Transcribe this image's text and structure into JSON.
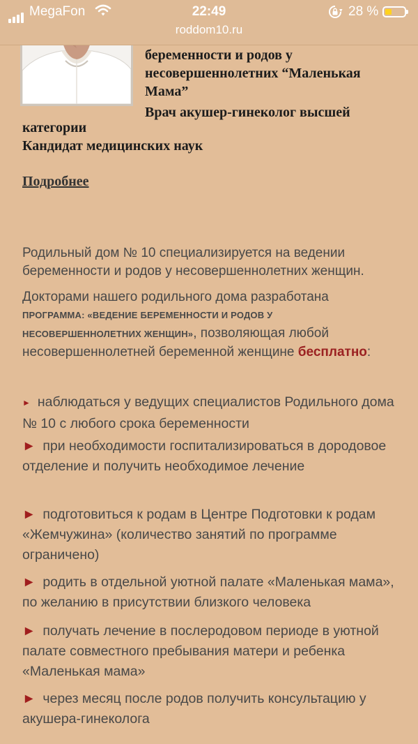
{
  "status_bar": {
    "carrier": "MegaFon",
    "time": "22:49",
    "battery_percent": "28 %",
    "battery_level": 0.28,
    "url": "roddom10.ru",
    "icons": [
      "signal-icon",
      "wifi-icon",
      "orientation-lock-icon",
      "battery-icon"
    ]
  },
  "doctor": {
    "right_lines": [
      "беременности и родов у",
      "несовершеннолетних “Маленькая",
      "Мама”",
      "Врач акушер-гинеколог высшей"
    ],
    "full_lines": [
      "категории",
      "Кандидат медицинских наук"
    ],
    "more_link": "Подробнее"
  },
  "intro": {
    "p1": "Родильный дом № 10 специализируется на ведении беременности и родов у несовершеннолетних женщин.",
    "p2_line1": "Докторами нашего родильного дома разработана",
    "p2_caps1": "ПРОГРАММА: «ВЕДЕНИЕ БЕРЕМЕННОСТИ И РОДОВ У",
    "p2_caps2": "НЕСОВЕРШЕННОЛЕТНИХ ЖЕНЩИН»",
    "p2_tail": ", позволяющая любой",
    "p2_line4": "несовершеннолетней беременной женщине ",
    "p2_free": "бесплатно",
    "p2_colon": ":"
  },
  "benefits": {
    "bullet": "►",
    "items": [
      "наблюдаться у ведущих специалистов Родильного дома № 10 с любого срока беременности",
      "при необходимости госпитализироваться в дородовое отделение и получить необходимое лечение",
      "подготовиться к родам в Центре Подготовки к родам «Жемчужина» (количество занятий по программе ограничено)",
      "родить в отдельной уютной палате «Маленькая мама», по желанию в присутствии близкого человека",
      "получать лечение в послеродовом периоде в уютной палате совместного пребывания матери и ребенка «Маленькая мама»",
      "через месяц после родов получить консультацию у акушера-гинеколога"
    ]
  },
  "colors": {
    "background": "#e2bd98",
    "accent_red": "#a01e1e",
    "text": "#484848"
  }
}
